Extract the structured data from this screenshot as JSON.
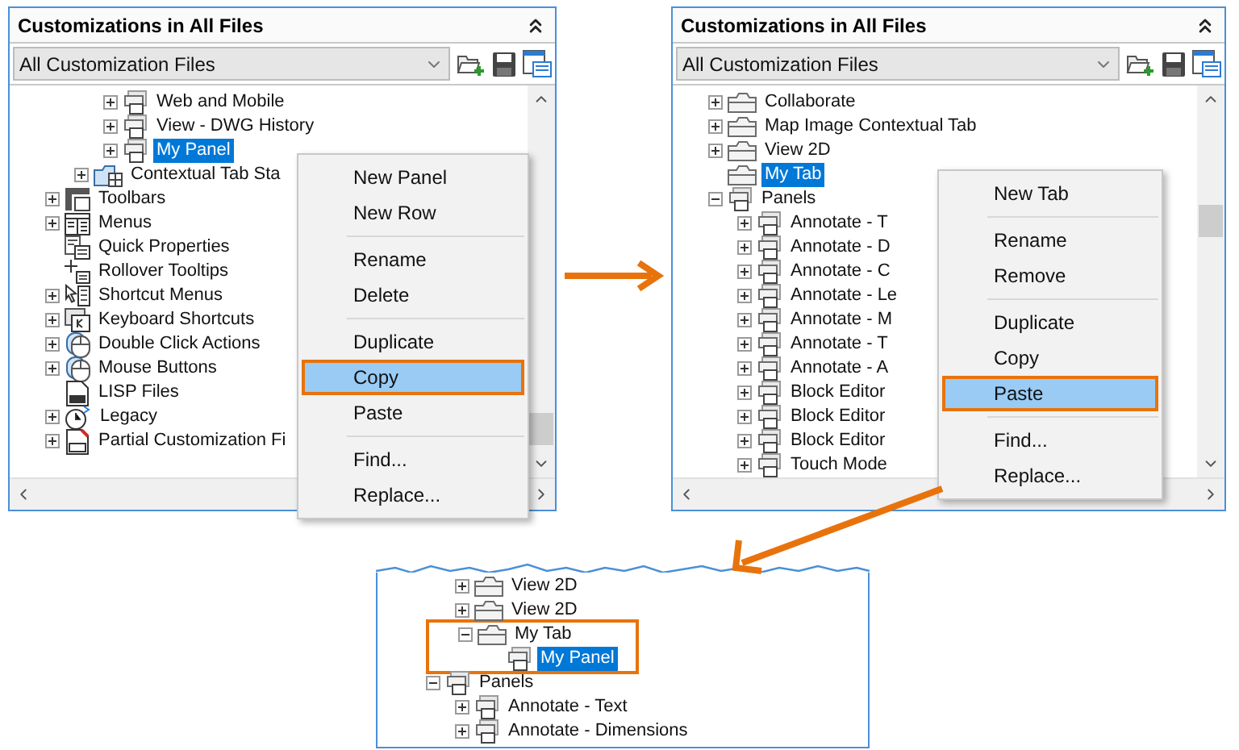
{
  "panels": [
    {
      "kind": "panel",
      "title": "Customizations in All Files",
      "dropdown": "All Customization Files",
      "tree": [
        {
          "children": [
            {
              "children": [
                {
                  "children": [
                    {
                      "label": "Web and Mobile",
                      "kind": "panel",
                      "expanded": false,
                      "selected": false
                    },
                    {
                      "label": "View - DWG History",
                      "kind": "panel",
                      "expanded": false,
                      "selected": false
                    },
                    {
                      "label": "My Panel",
                      "kind": "panel",
                      "expanded": false,
                      "selected": true
                    }
                  ]
                },
                {
                  "label": "Contextual Tab Sta",
                  "kind": "contextual",
                  "expanded": false,
                  "selected": false
                }
              ]
            },
            {
              "label": "Toolbars",
              "kind": "toolbar",
              "expanded": false,
              "selected": false
            },
            {
              "label": "Menus",
              "kind": "menu",
              "expanded": false,
              "selected": false
            },
            {
              "label": "Quick Properties",
              "kind": "properties",
              "selected": false
            },
            {
              "label": "Rollover Tooltips",
              "kind": "tooltip",
              "selected": false
            },
            {
              "label": "Shortcut Menus",
              "kind": "shortcut",
              "expanded": false,
              "selected": false
            },
            {
              "label": "Keyboard Shortcuts",
              "kind": "keyboard",
              "expanded": false,
              "selected": false
            },
            {
              "label": "Double Click Actions",
              "kind": "mouse",
              "expanded": false,
              "selected": false
            },
            {
              "label": "Mouse Buttons",
              "kind": "mouse",
              "expanded": false,
              "selected": false
            },
            {
              "label": "LISP Files",
              "kind": "lisp",
              "selected": false
            },
            {
              "label": "Legacy",
              "kind": "legacy",
              "expanded": false,
              "selected": false
            },
            {
              "label": "Partial Customization Fi",
              "kind": "cui",
              "expanded": false,
              "selected": false
            }
          ]
        }
      ],
      "menu": [
        {
          "label": "New Panel",
          "divider_before": false,
          "highlighted": false
        },
        {
          "label": "New Row",
          "divider_before": false,
          "highlighted": false
        },
        {
          "label": "Rename",
          "divider_before": true,
          "highlighted": false
        },
        {
          "label": "Delete",
          "divider_before": false,
          "highlighted": false
        },
        {
          "label": "Duplicate",
          "divider_before": true,
          "highlighted": false
        },
        {
          "label": "Copy",
          "divider_before": false,
          "highlighted": true
        },
        {
          "label": "Paste",
          "divider_before": false,
          "highlighted": false
        },
        {
          "label": "Find...",
          "divider_before": true,
          "highlighted": false
        },
        {
          "label": "Replace...",
          "divider_before": false,
          "highlighted": false
        }
      ]
    },
    {
      "kind": "panel",
      "title": "Customizations in All Files",
      "dropdown": "All Customization Files",
      "tree": [
        {
          "children": [
            {
              "label": "Collaborate",
              "kind": "tab",
              "expanded": false,
              "selected": false
            },
            {
              "label": "Map Image Contextual Tab",
              "kind": "tab",
              "expanded": false,
              "selected": false
            },
            {
              "label": "View 2D",
              "kind": "tab",
              "expanded": false,
              "selected": false
            },
            {
              "label": "My Tab",
              "kind": "tab",
              "selected": true
            },
            {
              "label": "Panels",
              "kind": "panel",
              "expanded": true,
              "selected": false,
              "children": [
                {
                  "label": "Annotate - T",
                  "kind": "panel",
                  "expanded": false,
                  "selected": false
                },
                {
                  "label": "Annotate - D",
                  "kind": "panel",
                  "expanded": false,
                  "selected": false
                },
                {
                  "label": "Annotate - C",
                  "kind": "panel",
                  "expanded": false,
                  "selected": false
                },
                {
                  "label": "Annotate - Le",
                  "kind": "panel",
                  "expanded": false,
                  "selected": false
                },
                {
                  "label": "Annotate - M",
                  "kind": "panel",
                  "expanded": false,
                  "selected": false
                },
                {
                  "label": "Annotate - T",
                  "kind": "panel",
                  "expanded": false,
                  "selected": false
                },
                {
                  "label": "Annotate - A",
                  "kind": "panel",
                  "expanded": false,
                  "selected": false
                },
                {
                  "label": "Block Editor",
                  "kind": "panel",
                  "expanded": false,
                  "selected": false
                },
                {
                  "label": "Block Editor",
                  "kind": "panel",
                  "expanded": false,
                  "selected": false
                },
                {
                  "label": "Block Editor",
                  "kind": "panel",
                  "expanded": false,
                  "selected": false
                },
                {
                  "label": "Touch Mode",
                  "kind": "panel",
                  "expanded": false,
                  "selected": false
                }
              ]
            }
          ]
        }
      ],
      "menu": [
        {
          "label": "New Tab",
          "divider_before": false,
          "highlighted": false
        },
        {
          "label": "Rename",
          "divider_before": true,
          "highlighted": false
        },
        {
          "label": "Remove",
          "divider_before": false,
          "highlighted": false
        },
        {
          "label": "Duplicate",
          "divider_before": true,
          "highlighted": false
        },
        {
          "label": "Copy",
          "divider_before": false,
          "highlighted": false
        },
        {
          "label": "Paste",
          "divider_before": false,
          "highlighted": true
        },
        {
          "label": "Find...",
          "divider_before": true,
          "highlighted": false
        },
        {
          "label": "Replace...",
          "divider_before": false,
          "highlighted": false
        }
      ]
    },
    {
      "kind": "fragment",
      "tree": [
        {
          "children": [
            {
              "label": "View 2D",
              "kind": "tab",
              "expanded": false,
              "selected": false
            },
            {
              "label": "View 2D",
              "kind": "tab",
              "expanded": false,
              "selected": false
            },
            {
              "label": "My Tab",
              "kind": "tab",
              "expanded": true,
              "selected": false,
              "callout": true,
              "children": [
                {
                  "label": "My Panel",
                  "kind": "panel",
                  "selected": true
                }
              ]
            }
          ]
        },
        {
          "label": "Panels",
          "kind": "panel",
          "expanded": true,
          "selected": false,
          "children": [
            {
              "label": "Annotate - Text",
              "kind": "panel",
              "expanded": false,
              "selected": false
            },
            {
              "label": "Annotate - Dimensions",
              "kind": "panel",
              "expanded": false,
              "selected": false
            }
          ]
        }
      ]
    }
  ]
}
